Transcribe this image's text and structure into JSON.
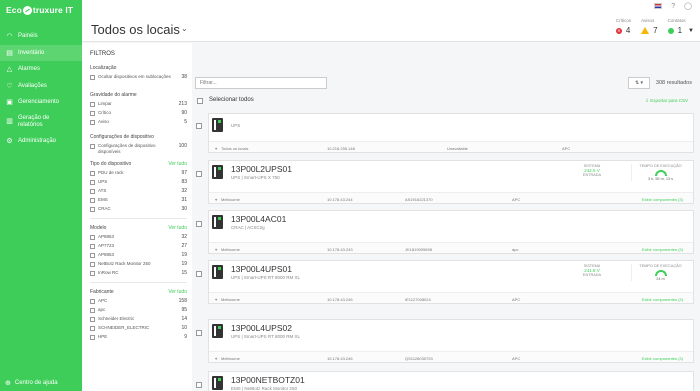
{
  "brand": {
    "name_pre": "Eco",
    "name_post": "truxure IT"
  },
  "sidebar": {
    "items": [
      {
        "label": "Painéis",
        "icon": "dashboard-icon"
      },
      {
        "label": "Inventário",
        "icon": "inventory-icon",
        "active": true
      },
      {
        "label": "Alarmes",
        "icon": "alarm-icon"
      },
      {
        "label": "Avaliações",
        "icon": "assessment-icon"
      },
      {
        "label": "Gerenciamento",
        "icon": "management-icon"
      },
      {
        "label": "Geração de relatórios",
        "icon": "reports-icon"
      },
      {
        "label": "Administração",
        "icon": "admin-icon"
      }
    ],
    "help": "Centro de ajuda"
  },
  "header": {
    "title": "Todos os locais",
    "counters": {
      "critical": {
        "label": "Críticos",
        "value": "4"
      },
      "warning": {
        "label": "Avisos",
        "value": "7"
      },
      "contacts": {
        "label": "Contatos",
        "value": "1"
      }
    }
  },
  "filters": {
    "title": "FILTROS",
    "location": {
      "heading": "Localização",
      "option": "Ocultar dispositivos em sublocações",
      "count": "38"
    },
    "severity": {
      "heading": "Gravidade do alarme",
      "rows": [
        {
          "label": "Limpar",
          "count": "213"
        },
        {
          "label": "Crítico",
          "count": "90"
        },
        {
          "label": "Aviso",
          "count": "5"
        }
      ]
    },
    "config": {
      "heading": "Configurações de dispositivo",
      "option": "Configurações de dispositivo disponíveis",
      "count": "100"
    },
    "type": {
      "heading": "Tipo do dispositivo",
      "see_all": "Ver tudo",
      "rows": [
        {
          "label": "PDU de rack",
          "count": "97"
        },
        {
          "label": "UPS",
          "count": "83"
        },
        {
          "label": "ATS",
          "count": "32"
        },
        {
          "label": "EMS",
          "count": "31"
        },
        {
          "label": "CRAC",
          "count": "30"
        }
      ]
    },
    "model": {
      "heading": "Modelo",
      "see_all": "Ver tudo",
      "rows": [
        {
          "label": "AP8853",
          "count": "32"
        },
        {
          "label": "AP7723",
          "count": "27"
        },
        {
          "label": "AP8853",
          "count": "19"
        },
        {
          "label": "NetBotz Rack Monitor 250",
          "count": "19"
        },
        {
          "label": "InRow RC",
          "count": "15"
        }
      ]
    },
    "vendor": {
      "heading": "Fabricante",
      "see_all": "Ver tudo",
      "rows": [
        {
          "label": "APC",
          "count": "158"
        },
        {
          "label": "apc",
          "count": "95"
        },
        {
          "label": "Schneider Electric",
          "count": "14"
        },
        {
          "label": "SCHNEIDER_ELECTRIC",
          "count": "10"
        },
        {
          "label": "HPE",
          "count": "9"
        }
      ]
    }
  },
  "list": {
    "filter_placeholder": "Filtrar...",
    "sort_label": "⇅ ▾",
    "results": "308 resultados",
    "export": "Exportar para CSV",
    "select_all": "Selecionar todos",
    "show_components": "Exibir componentes (3)",
    "devices": [
      {
        "name": "",
        "sub": "UPS",
        "site": "Todos os locais",
        "ip": "10.216.255.148",
        "serial": "Unavailable",
        "vendor": "APC",
        "show": ""
      },
      {
        "name": "13P00L2UPS01",
        "sub": "UPS | Smart-UPS X 750",
        "site": "Melbourne",
        "ip": "10.178.43.244",
        "serial": "AS1916221370",
        "vendor": "APC",
        "show": "Exibir componentes (3)",
        "status": {
          "label": "SISTEMA",
          "value": "242.5 V",
          "sub": "ENTRADA"
        },
        "runtime": {
          "label": "TEMPO DE EXECUÇÃO",
          "value": "3 h, 55 m, 13 s"
        }
      },
      {
        "name": "13P00L4AC01",
        "sub": "CRAC | ACSC2g",
        "site": "Melbourne",
        "ip": "10.178.43.243",
        "serial": "JK1819005698",
        "vendor": "apc",
        "show": "Exibir componentes (3)"
      },
      {
        "name": "13P00L4UPS01",
        "sub": "UPS | Smart-UPS RT 8000 RM XL",
        "site": "Melbourne",
        "ip": "10.178.43.245",
        "serial": "IE1127008024",
        "vendor": "APC",
        "show": "Exibir componentes (3)",
        "status": {
          "label": "SISTEMA",
          "value": "241.8 V",
          "sub": "ENTRADA"
        },
        "runtime": {
          "label": "TEMPO DE EXECUÇÃO",
          "value": "24 m"
        }
      },
      {
        "name": "13P00L4UPS02",
        "sub": "UPS | Smart-UPS RT 8000 RM XL",
        "site": "Melbourne",
        "ip": "10.178.43.246",
        "serial": "QS1128030793",
        "vendor": "APC",
        "show": "Exibir componentes (3)"
      },
      {
        "name": "13P00NETBOTZ01",
        "sub": "EMS | NetBotz Rack Monitor 250",
        "site": "",
        "ip": "",
        "serial": "",
        "vendor": "",
        "show": ""
      }
    ]
  }
}
